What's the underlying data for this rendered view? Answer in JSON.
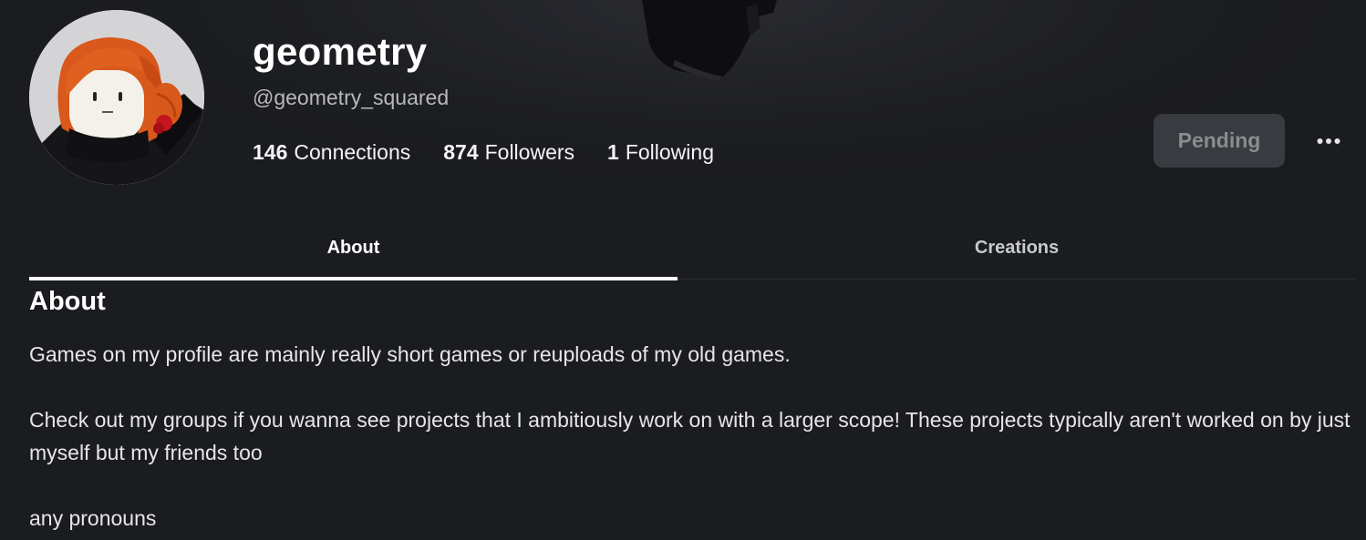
{
  "profile": {
    "display_name": "geometry",
    "username": "@geometry_squared",
    "avatar_icon": "roblox-avatar-red-hair"
  },
  "stats": {
    "connections": {
      "count": "146",
      "label": "Connections"
    },
    "followers": {
      "count": "874",
      "label": "Followers"
    },
    "following": {
      "count": "1",
      "label": "Following"
    }
  },
  "actions": {
    "pending_label": "Pending",
    "more_icon": "ellipsis-icon"
  },
  "tabs": [
    {
      "label": "About",
      "active": true
    },
    {
      "label": "Creations",
      "active": false
    }
  ],
  "about": {
    "heading": "About",
    "paragraphs": [
      "Games on my profile are mainly really short games or reuploads of my old games.",
      "Check out my groups if you wanna see projects that I ambitiously work on with a larger scope! These projects typically aren't worked on by just myself but my friends too",
      "any pronouns"
    ]
  },
  "colors": {
    "background": "#1b1c20",
    "text_primary": "#ffffff",
    "text_secondary": "#b8b9bc",
    "pending_bg": "#393b40",
    "pending_text": "#8b8c90"
  }
}
